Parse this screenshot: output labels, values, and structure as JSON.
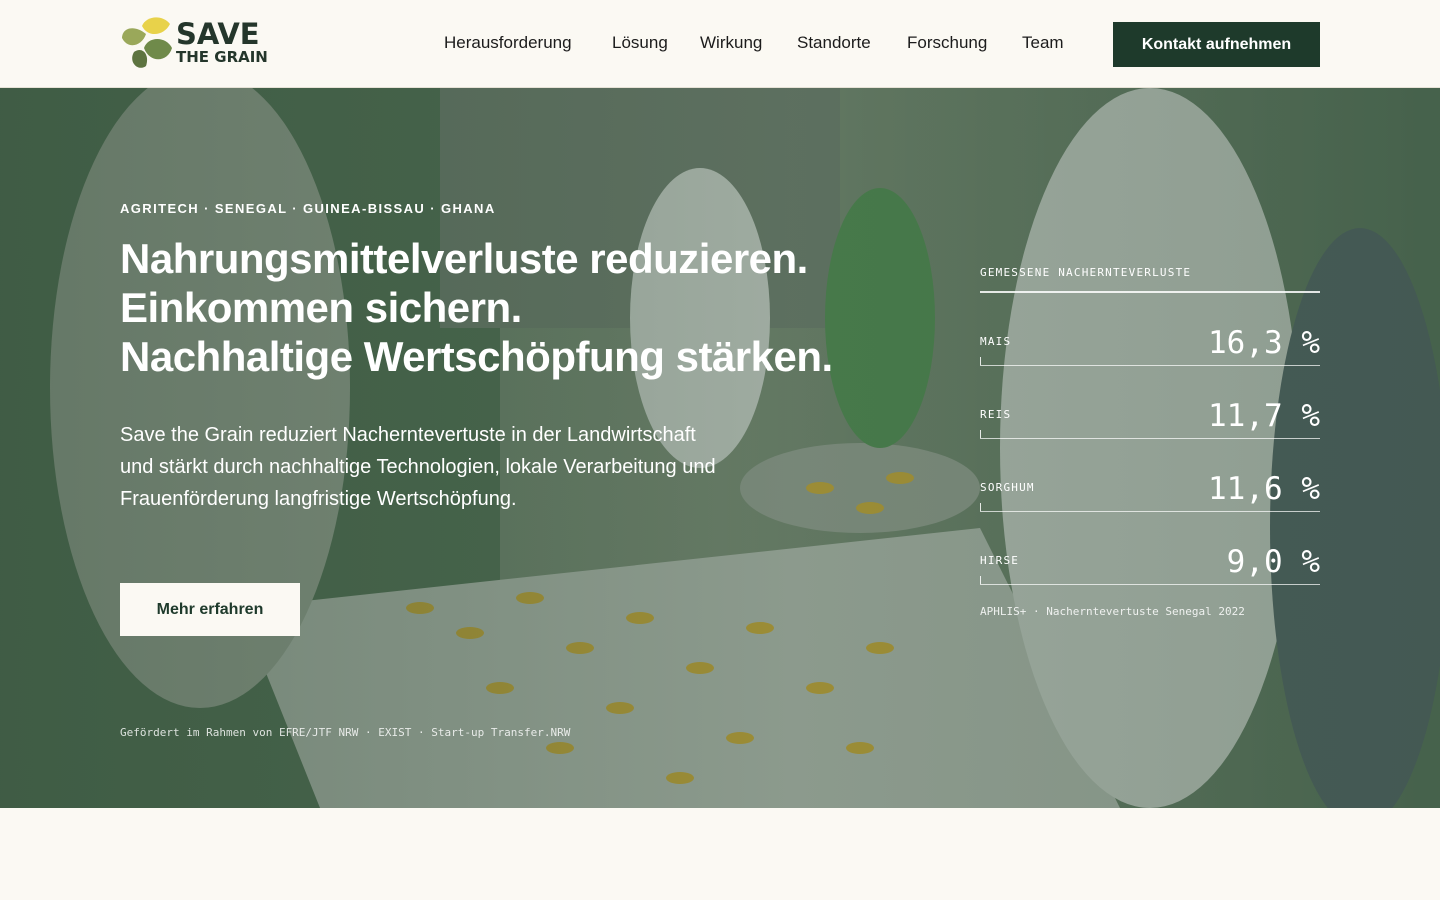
{
  "logo": {
    "line1": "SAVE",
    "line2": "THE GRAIN"
  },
  "nav": {
    "items": [
      "Herausforderung",
      "Lösung",
      "Wirkung",
      "Standorte",
      "Forschung",
      "Team"
    ],
    "cta": "Kontakt aufnehmen"
  },
  "hero": {
    "eyebrow": "AGRITECH · SENEGAL · GUINEA-BISSAU · GHANA",
    "headline": [
      "Nahrungsmittelverluste reduzieren.",
      "Einkommen sichern.",
      "Nachhaltige Wertschöpfung stärken."
    ],
    "lead": "Save the Grain reduziert Nacherntevertuste in der Landwirtschaft und stärkt durch nachhaltige Technologien, lokale Verarbeitung und Frauenförderung langfristige Wertschöpfung.",
    "button": "Mehr erfahren",
    "funding": "Gefördert im Rahmen von EFRE/JTF NRW · EXIST · Start-up Transfer.NRW"
  },
  "stats": {
    "title": "GEMESSENE NACHERNTEVERLUSTE",
    "rows": [
      {
        "label": "MAIS",
        "value": "16,3 %"
      },
      {
        "label": "REIS",
        "value": "11,7 %"
      },
      {
        "label": "SORGHUM",
        "value": "11,6 %"
      },
      {
        "label": "HIRSE",
        "value": "9,0 %"
      }
    ],
    "source": "APHLIS+ · Nacherntevertuste Senegal 2022"
  },
  "colors": {
    "brand_green": "#1e3a2b",
    "background": "#fbf9f3",
    "leaf_green": "#6f8a4a",
    "leaf_yellow": "#e8d24a",
    "leaf_olive": "#9aa85a"
  }
}
